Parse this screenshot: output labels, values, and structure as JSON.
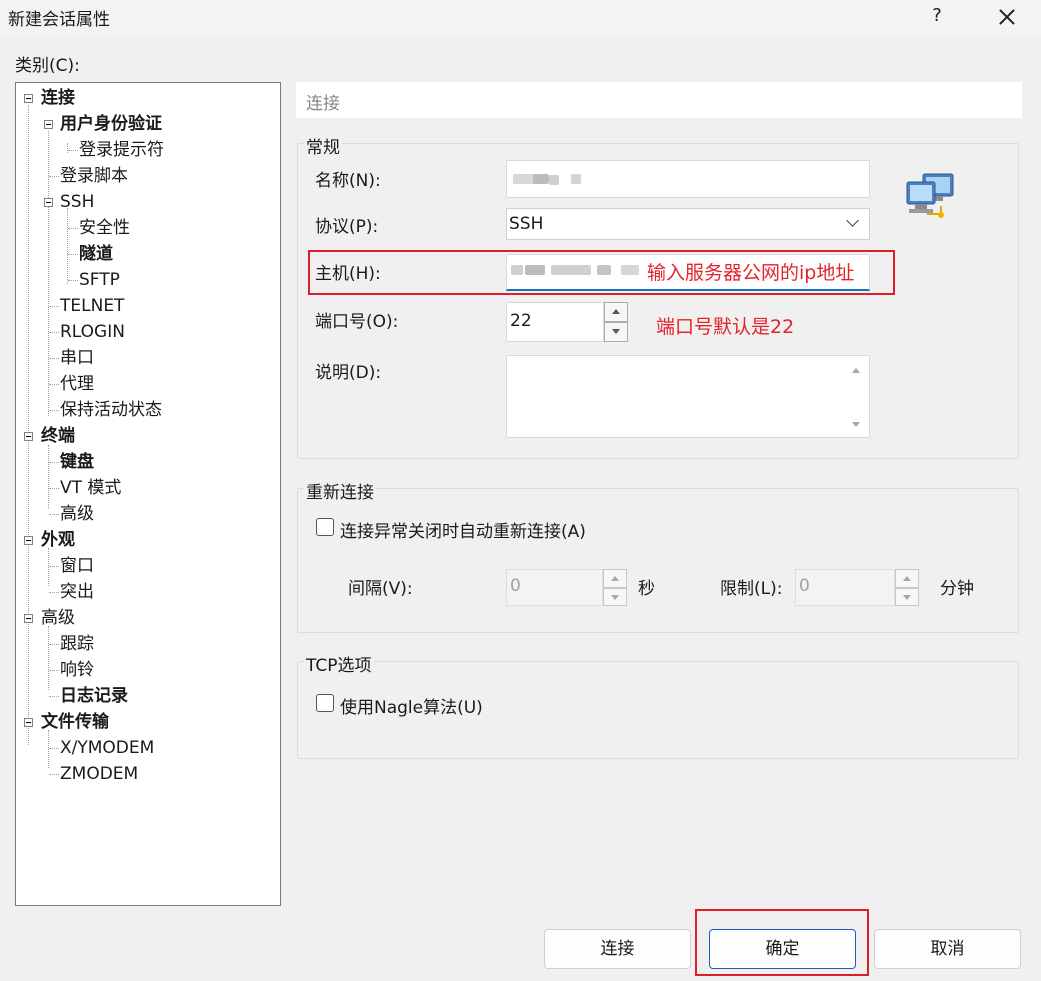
{
  "window": {
    "title": "新建会话属性",
    "help": "?"
  },
  "category_label": "类别(C):",
  "tree": {
    "connection": "连接",
    "auth": "用户身份验证",
    "login_prompt": "登录提示符",
    "login_script": "登录脚本",
    "ssh": "SSH",
    "security": "安全性",
    "tunnel": "隧道",
    "sftp": "SFTP",
    "telnet": "TELNET",
    "rlogin": "RLOGIN",
    "serial": "串口",
    "proxy": "代理",
    "keepalive": "保持活动状态",
    "terminal": "终端",
    "keyboard": "键盘",
    "vt_mode": "VT 模式",
    "terminal_advanced": "高级",
    "appearance": "外观",
    "window": "窗口",
    "highlight": "突出",
    "advanced": "高级",
    "trace": "跟踪",
    "bell": "响铃",
    "logging": "日志记录",
    "file_transfer": "文件传输",
    "xymodem": "X/YMODEM",
    "zmodem": "ZMODEM"
  },
  "section_title": "连接",
  "general": {
    "group_title": "常规",
    "name_label": "名称(N):",
    "protocol_label": "协议(P):",
    "protocol_value": "SSH",
    "host_label": "主机(H):",
    "port_label": "端口号(O):",
    "port_value": "22",
    "desc_label": "说明(D):"
  },
  "reconnect": {
    "group_title": "重新连接",
    "checkbox_label": "连接异常关闭时自动重新连接(A)",
    "checked": false,
    "interval_label": "间隔(V):",
    "interval_value": "0",
    "interval_unit": "秒",
    "limit_label": "限制(L):",
    "limit_value": "0",
    "limit_unit": "分钟"
  },
  "tcp": {
    "group_title": "TCP选项",
    "nagle_label": "使用Nagle算法(U)",
    "checked": false
  },
  "annotations": {
    "host_note": "输入服务器公网的ip地址",
    "port_note": "端口号默认是22",
    "color": "#e3242b"
  },
  "buttons": {
    "connect": "连接",
    "ok": "确定",
    "cancel": "取消"
  },
  "icons": {
    "network": "network-computers-icon"
  }
}
